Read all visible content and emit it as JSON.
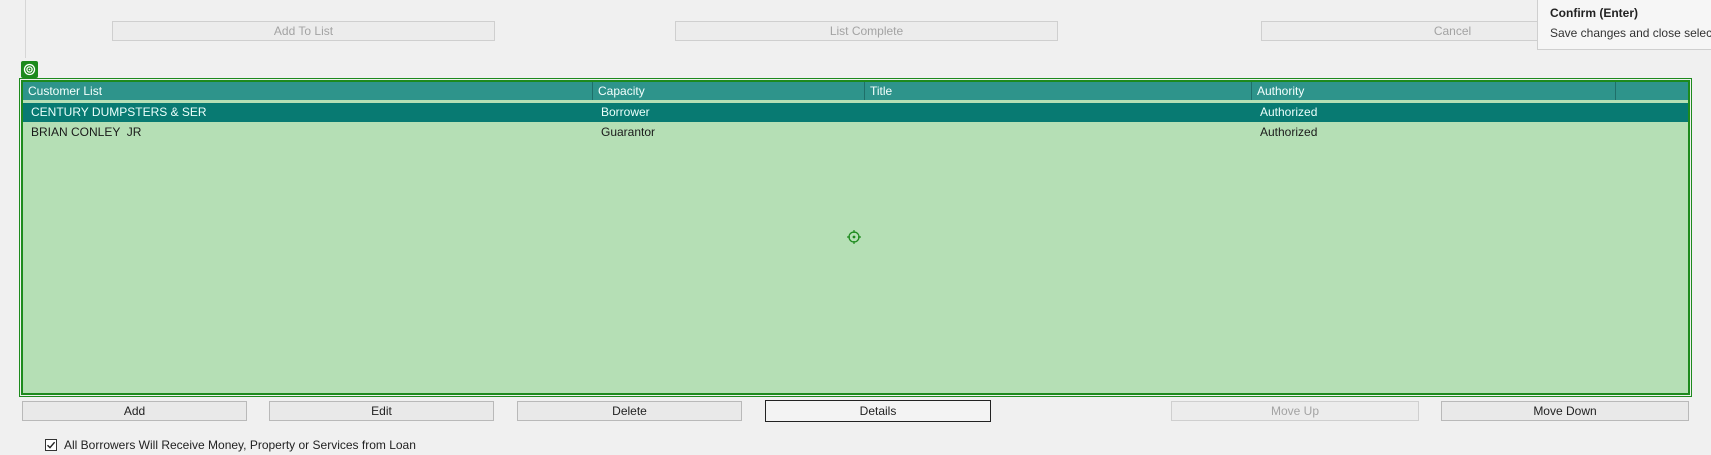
{
  "toolbar": {
    "add_to_list": "Add To List",
    "list_complete": "List Complete",
    "cancel": "Cancel"
  },
  "tooltip": {
    "title": "Confirm (Enter)",
    "text": "Save changes and close selecti"
  },
  "grid": {
    "columns": [
      "Customer List",
      "Capacity",
      "Title",
      "Authority"
    ],
    "rows": [
      {
        "customer": "CENTURY DUMPSTERS & SER",
        "capacity": "Borrower",
        "title": "",
        "authority": "Authorized",
        "selected": true
      },
      {
        "customer": "BRIAN CONLEY  JR",
        "capacity": "Guarantor",
        "title": "",
        "authority": "Authorized",
        "selected": false
      }
    ]
  },
  "actions": {
    "add": "Add",
    "edit": "Edit",
    "delete": "Delete",
    "details": "Details",
    "move_up": "Move Up",
    "move_down": "Move Down"
  },
  "checkbox": {
    "label": "All Borrowers Will Receive Money, Property or Services from Loan",
    "checked": true
  },
  "colors": {
    "grid_border": "#1d8a1d",
    "grid_background": "#b5dfb5",
    "header_background": "#2e948b",
    "selected_row": "#087a72"
  },
  "icons": {
    "grid_badge": "target-icon",
    "center_marker": "crosshair-icon",
    "check": "checkmark-icon"
  }
}
